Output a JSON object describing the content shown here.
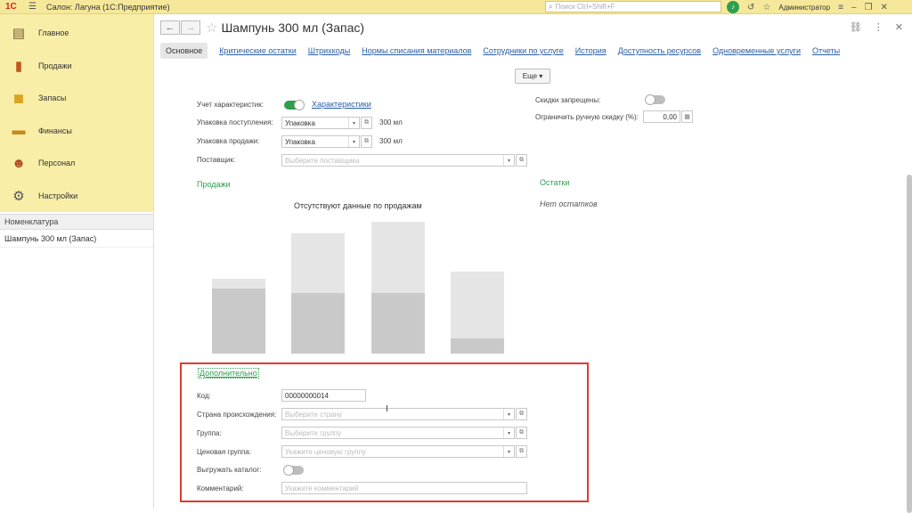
{
  "titlebar": {
    "logo": "1С",
    "app_title": "Салон: Лагуна  (1С:Предприятие)",
    "search_placeholder": "Поиск Ctrl+Shift+F",
    "user": "Администратор"
  },
  "sidebar": {
    "sections": [
      {
        "label": "Главное",
        "icon": "doc-icon",
        "color": "#7a5a2e",
        "glyph": "▤"
      },
      {
        "label": "Продажи",
        "icon": "chart-icon",
        "color": "#c2571b",
        "glyph": "▮"
      },
      {
        "label": "Запасы",
        "icon": "box-icon",
        "color": "#d9a420",
        "glyph": "◼"
      },
      {
        "label": "Финансы",
        "icon": "wallet-icon",
        "color": "#c88a1c",
        "glyph": "▬"
      },
      {
        "label": "Персонал",
        "icon": "people-icon",
        "color": "#b04a25",
        "glyph": "☻"
      },
      {
        "label": "Настройки",
        "icon": "gear-icon",
        "color": "#555555",
        "glyph": "⚙"
      }
    ],
    "open_header": "Номенклатура",
    "open_item": "Шампунь 300 мл (Запас)"
  },
  "header": {
    "title": "Шампунь 300 мл (Запас)"
  },
  "tabs": [
    "Основное",
    "Критические остатки",
    "Штрихкоды",
    "Нормы списания материалов",
    "Сотрудники по услуге",
    "История",
    "Доступность ресурсов",
    "Одновременные услуги",
    "Отчеты"
  ],
  "more_label": "Еще",
  "form": {
    "char_label": "Учет характеристик:",
    "char_link": "Характеристики",
    "pack_in_label": "Упаковка поступления:",
    "pack_in_value": "Упаковка",
    "pack_in_unit": "300 мл",
    "pack_out_label": "Упаковка продажи:",
    "pack_out_value": "Упаковка",
    "pack_out_unit": "300 мл",
    "supplier_label": "Поставщик:",
    "supplier_placeholder": "Выберите поставщика",
    "discount_label": "Скидки запрещены:",
    "limit_label": "Ограничить ручную скидку (%):",
    "limit_value": "0,00"
  },
  "sales": {
    "title": "Продажи",
    "note": "Отсутствуют данные по продажам"
  },
  "stock": {
    "title": "Остатки",
    "note": "Нет остатков"
  },
  "additional": {
    "title": "Дополнительно",
    "code_label": "Код:",
    "code_value": "00000000014",
    "country_label": "Страна происхождения:",
    "country_placeholder": "Выберите страну",
    "group_label": "Группа:",
    "group_placeholder": "Выберите группу",
    "price_group_label": "Ценовая группа:",
    "price_group_placeholder": "Укажите ценовую группу",
    "catalog_label": "Выгружать каталог:",
    "comment_label": "Комментарий:",
    "comment_placeholder": "Укажите комментарий"
  },
  "colors": {
    "accent_green": "#2e9f4c",
    "link_blue": "#2a5ea8",
    "highlight_red": "#e03a2d",
    "panel_yellow": "#f8eea8"
  }
}
